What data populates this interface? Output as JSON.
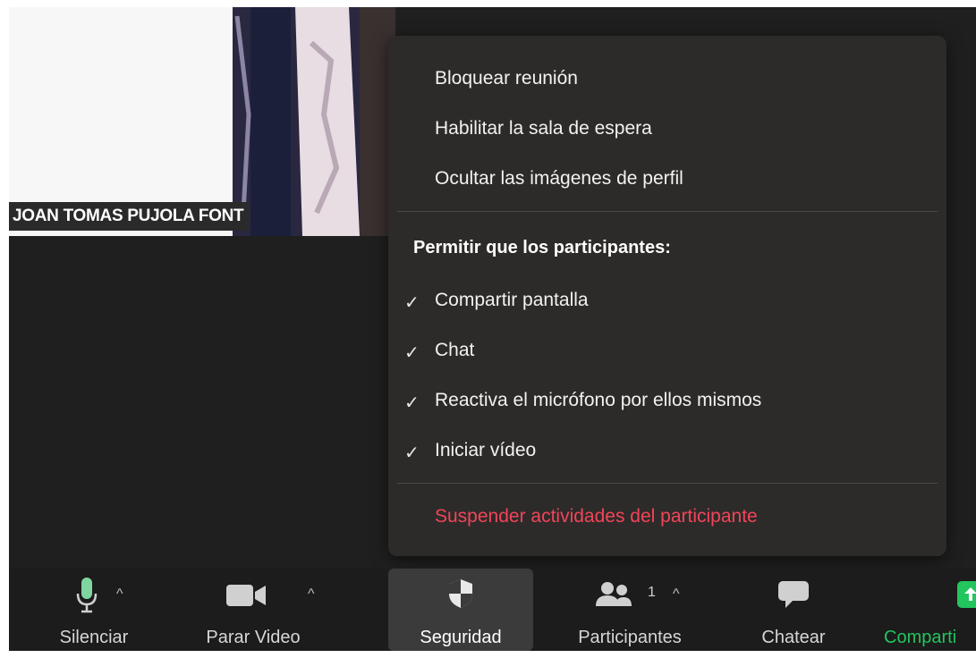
{
  "video_tile": {
    "participant_name": "JOAN TOMAS PUJOLA FONT"
  },
  "security_menu": {
    "items": [
      {
        "label": "Bloquear reunión"
      },
      {
        "label": "Habilitar la sala de espera"
      },
      {
        "label": "Ocultar las imágenes de perfil"
      }
    ],
    "section_header": "Permitir que los participantes:",
    "permissions": [
      {
        "label": "Compartir pantalla",
        "checked": true
      },
      {
        "label": "Chat",
        "checked": true
      },
      {
        "label": "Reactiva el micrófono por ellos mismos",
        "checked": true
      },
      {
        "label": "Iniciar vídeo",
        "checked": true
      }
    ],
    "suspend_label": "Suspender actividades del participante",
    "check_glyph": "✓"
  },
  "toolbar": {
    "mute": {
      "label": "Silenciar",
      "icon": "microphone-icon"
    },
    "video": {
      "label": "Parar Video",
      "icon": "video-camera-icon"
    },
    "security": {
      "label": "Seguridad",
      "icon": "shield-icon"
    },
    "participants": {
      "label": "Participantes",
      "icon": "participants-icon",
      "count": "1"
    },
    "chat": {
      "label": "Chatear",
      "icon": "chat-bubble-icon"
    },
    "share": {
      "label": "Comparti",
      "icon": "share-screen-icon"
    },
    "caret_glyph": "^"
  },
  "colors": {
    "accent_green": "#22c55e",
    "mic_green": "#7fd6a0",
    "danger_red": "#f2445a",
    "menu_bg": "#2d2b29",
    "toolbar_bg": "#1c1c1c"
  }
}
